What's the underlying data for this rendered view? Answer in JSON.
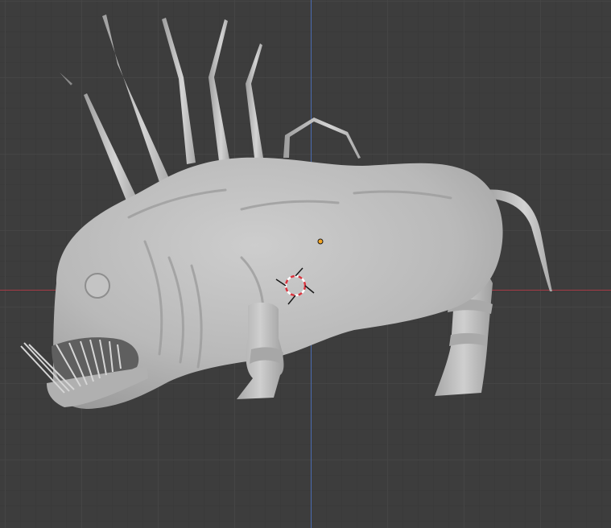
{
  "viewport": {
    "mode": "3d-viewport",
    "shading": "solid",
    "grid": true,
    "colors": {
      "background": "#3d3d3d",
      "grid_major": "#464646",
      "grid_minor": "#3a3a3a",
      "x_axis": "#a63a45",
      "y_axis": "#4a6bb0",
      "mesh": "#bdbdbd",
      "origin_dot": "#f5a623",
      "cursor_red": "#d9353f",
      "cursor_white": "#ffffff"
    }
  },
  "object": {
    "type": "sculpted-creature-mesh"
  }
}
